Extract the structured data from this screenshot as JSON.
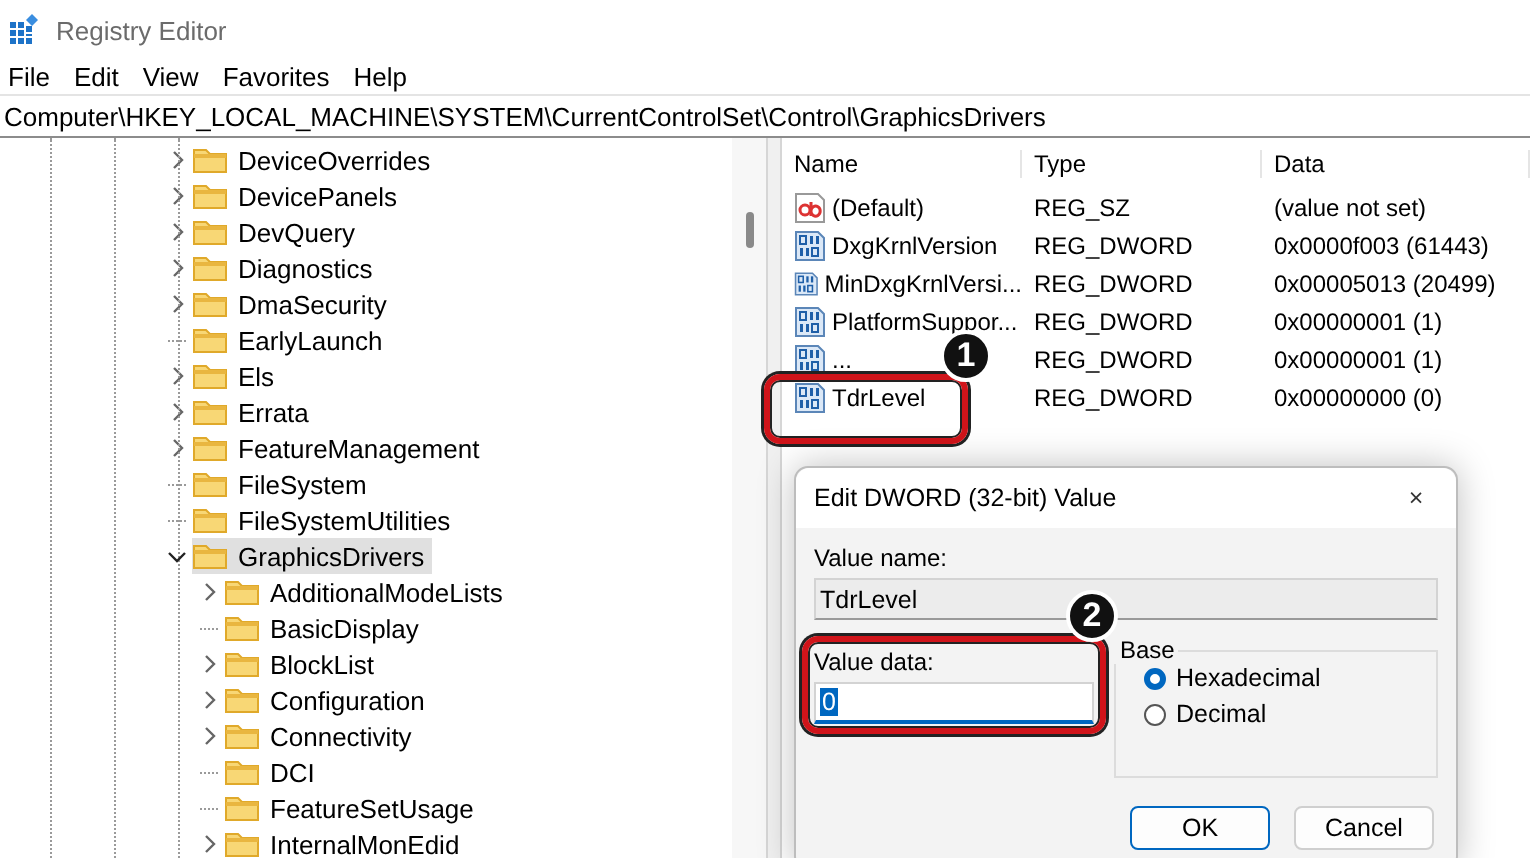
{
  "window": {
    "title": "Registry Editor"
  },
  "menu": [
    "File",
    "Edit",
    "View",
    "Favorites",
    "Help"
  ],
  "address": "Computer\\HKEY_LOCAL_MACHINE\\SYSTEM\\CurrentControlSet\\Control\\GraphicsDrivers",
  "tree": [
    {
      "label": "DeviceOverrides",
      "has_children": true,
      "expanded": false,
      "selected": false
    },
    {
      "label": "DevicePanels",
      "has_children": true,
      "expanded": false,
      "selected": false
    },
    {
      "label": "DevQuery",
      "has_children": true,
      "expanded": false,
      "selected": false
    },
    {
      "label": "Diagnostics",
      "has_children": true,
      "expanded": false,
      "selected": false
    },
    {
      "label": "DmaSecurity",
      "has_children": true,
      "expanded": false,
      "selected": false
    },
    {
      "label": "EarlyLaunch",
      "has_children": false,
      "expanded": false,
      "selected": false
    },
    {
      "label": "Els",
      "has_children": true,
      "expanded": false,
      "selected": false
    },
    {
      "label": "Errata",
      "has_children": true,
      "expanded": false,
      "selected": false
    },
    {
      "label": "FeatureManagement",
      "has_children": true,
      "expanded": false,
      "selected": false
    },
    {
      "label": "FileSystem",
      "has_children": false,
      "expanded": false,
      "selected": false
    },
    {
      "label": "FileSystemUtilities",
      "has_children": false,
      "expanded": false,
      "selected": false
    },
    {
      "label": "GraphicsDrivers",
      "has_children": true,
      "expanded": true,
      "selected": true,
      "children": [
        {
          "label": "AdditionalModeLists",
          "has_children": true,
          "expanded": false,
          "selected": false
        },
        {
          "label": "BasicDisplay",
          "has_children": false,
          "expanded": false,
          "selected": false
        },
        {
          "label": "BlockList",
          "has_children": true,
          "expanded": false,
          "selected": false
        },
        {
          "label": "Configuration",
          "has_children": true,
          "expanded": false,
          "selected": false
        },
        {
          "label": "Connectivity",
          "has_children": true,
          "expanded": false,
          "selected": false
        },
        {
          "label": "DCI",
          "has_children": false,
          "expanded": false,
          "selected": false
        },
        {
          "label": "FeatureSetUsage",
          "has_children": false,
          "expanded": false,
          "selected": false
        },
        {
          "label": "InternalMonEdid",
          "has_children": true,
          "expanded": false,
          "selected": false
        }
      ]
    }
  ],
  "values": {
    "columns": [
      "Name",
      "Type",
      "Data"
    ],
    "rows": [
      {
        "kind": "string",
        "name": "(Default)",
        "type": "REG_SZ",
        "data": "(value not set)"
      },
      {
        "kind": "dword",
        "name": "DxgKrnlVersion",
        "type": "REG_DWORD",
        "data": "0x0000f003 (61443)"
      },
      {
        "kind": "dword",
        "name": "MinDxgKrnlVersi...",
        "type": "REG_DWORD",
        "data": "0x00005013 (20499)"
      },
      {
        "kind": "dword",
        "name": "PlatformSuppor...",
        "type": "REG_DWORD",
        "data": "0x00000001 (1)"
      },
      {
        "kind": "dword",
        "name": "...",
        "type": "REG_DWORD",
        "data": "0x00000001 (1)"
      },
      {
        "kind": "dword",
        "name": "TdrLevel",
        "type": "REG_DWORD",
        "data": "0x00000000 (0)"
      }
    ]
  },
  "dialog": {
    "title": "Edit DWORD (32-bit) Value",
    "close": "×",
    "value_name_label": "Value name:",
    "value_name": "TdrLevel",
    "value_data_label": "Value data:",
    "value_data": "0",
    "base_label": "Base",
    "bases": [
      {
        "label": "Hexadecimal",
        "selected": true
      },
      {
        "label": "Decimal",
        "selected": false
      }
    ],
    "buttons": [
      "OK",
      "Cancel"
    ]
  },
  "annotations": [
    "1",
    "2"
  ]
}
